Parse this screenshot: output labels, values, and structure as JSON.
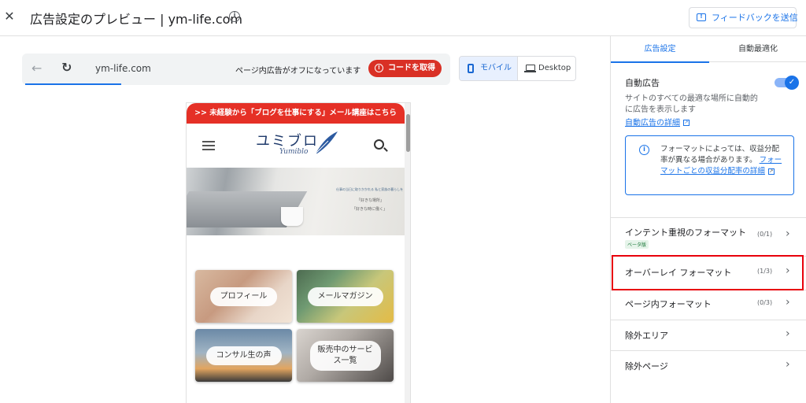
{
  "header": {
    "close_icon": "close-icon",
    "title": "広告設定のプレビュー | ym-life.com",
    "feedback_label": "フィードバックを送信"
  },
  "browser": {
    "url": "ym-life.com",
    "ads_status": "ページ内広告がオフになっています",
    "get_code_label": "コードを取得",
    "device_mobile": "モバイル",
    "device_desktop": "Desktop",
    "selected_device": "モバイル"
  },
  "phone": {
    "banner": ">> 未経験から「ブログを仕事にする」メール講座はこちら",
    "logo_jp": "ユミブロ",
    "logo_en": "Yumiblo",
    "hero_text1": "仕事の当日に取りかかれる 私と家族の暮らしを",
    "hero_text2": "「好きな場所」",
    "hero_text3": "「好きな時に働く」",
    "tiles": [
      {
        "label": "プロフィール"
      },
      {
        "label": "メールマガジン"
      },
      {
        "label": "コンサル生の声"
      },
      {
        "label": "販売中のサービス一覧",
        "line1": "販売中のサービ",
        "line2": "ス一覧"
      }
    ]
  },
  "panel": {
    "tabs": [
      "広告設定",
      "自動最適化"
    ],
    "active_tab": "広告設定",
    "auto_ads_label": "自動広告",
    "auto_ads_enabled": true,
    "auto_ads_desc": "サイトのすべての最適な場所に自動的に広告を表示します",
    "auto_ads_link": "自動広告の詳細",
    "info_text": "フォーマットによっては、収益分配率が異なる場合があります。",
    "info_link": "フォーマットごとの収益分配率の詳細",
    "rows": [
      {
        "label": "インテント重視のフォーマット",
        "count": "(0/1)",
        "badge": "ベータ版"
      },
      {
        "label": "オーバーレイ フォーマット",
        "count": "(1/3)"
      },
      {
        "label": "ページ内フォーマット",
        "count": "(0/3)"
      },
      {
        "label": "除外エリア"
      },
      {
        "label": "除外ページ"
      }
    ]
  },
  "colors": {
    "accent": "#1a73e8",
    "danger": "#d93025",
    "highlight": "#e8000b"
  }
}
